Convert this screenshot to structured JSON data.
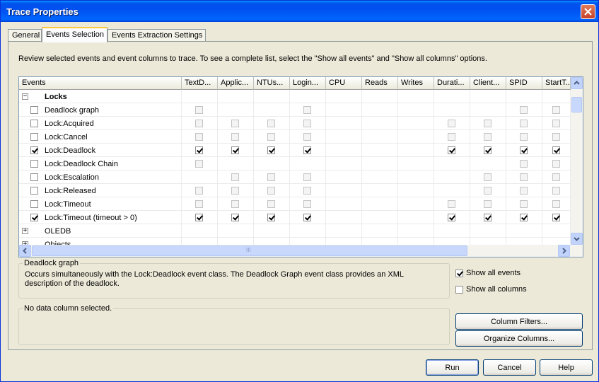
{
  "window": {
    "title": "Trace Properties"
  },
  "tabs": [
    {
      "label": "General"
    },
    {
      "label": "Events Selection"
    },
    {
      "label": "Events Extraction Settings"
    }
  ],
  "intro_text": "Review selected events and event columns to trace. To see a complete list, select the \"Show all events\" and \"Show all columns\" options.",
  "grid": {
    "columns": [
      "Events",
      "TextD...",
      "Applic...",
      "NTUs...",
      "Login...",
      "CPU",
      "Reads",
      "Writes",
      "Durati...",
      "Client...",
      "SPID",
      "StartT..."
    ],
    "category": {
      "label": "Locks",
      "expander": "−"
    },
    "rows": [
      {
        "label": "Deadlock graph",
        "checked": false,
        "cells": [
          "u",
          "",
          "",
          "u",
          "",
          "",
          "",
          "",
          "",
          "u",
          "u"
        ]
      },
      {
        "label": "Lock:Acquired",
        "checked": false,
        "cells": [
          "u",
          "u",
          "u",
          "u",
          "",
          "",
          "",
          "u",
          "u",
          "u",
          "u"
        ]
      },
      {
        "label": "Lock:Cancel",
        "checked": false,
        "cells": [
          "u",
          "u",
          "u",
          "u",
          "",
          "",
          "",
          "u",
          "u",
          "u",
          "u"
        ]
      },
      {
        "label": "Lock:Deadlock",
        "checked": true,
        "cells": [
          "c",
          "c",
          "c",
          "c",
          "",
          "",
          "",
          "c",
          "c",
          "c",
          "c"
        ]
      },
      {
        "label": "Lock:Deadlock Chain",
        "checked": false,
        "cells": [
          "u",
          "",
          "",
          "",
          "",
          "",
          "",
          "",
          "",
          "u",
          "u"
        ]
      },
      {
        "label": "Lock:Escalation",
        "checked": false,
        "cells": [
          "",
          "u",
          "u",
          "u",
          "",
          "",
          "",
          "",
          "u",
          "u",
          "u"
        ]
      },
      {
        "label": "Lock:Released",
        "checked": false,
        "cells": [
          "u",
          "u",
          "u",
          "u",
          "",
          "",
          "",
          "",
          "u",
          "u",
          "u"
        ]
      },
      {
        "label": "Lock:Timeout",
        "checked": false,
        "cells": [
          "u",
          "u",
          "u",
          "u",
          "",
          "",
          "",
          "u",
          "u",
          "u",
          "u"
        ]
      },
      {
        "label": "Lock:Timeout (timeout > 0)",
        "checked": true,
        "cells": [
          "c",
          "c",
          "c",
          "c",
          "",
          "",
          "",
          "c",
          "c",
          "c",
          "c"
        ]
      }
    ],
    "collapsed": [
      {
        "label": "OLEDB",
        "expander": "+"
      },
      {
        "label": "Objects",
        "expander": "+"
      }
    ],
    "hscroll_mark": "III"
  },
  "description": {
    "title": "Deadlock graph",
    "text": "Occurs simultaneously with the Lock:Deadlock event class. The Deadlock Graph event class provides an XML description of the deadlock."
  },
  "options": {
    "show_all_events": {
      "label": "Show all events",
      "checked": true
    },
    "show_all_columns": {
      "label": "Show all columns",
      "checked": false
    }
  },
  "column_info": {
    "title": "No data column selected."
  },
  "buttons": {
    "column_filters": "Column Filters...",
    "organize_columns": "Organize Columns...",
    "run": "Run",
    "cancel": "Cancel",
    "help": "Help"
  }
}
